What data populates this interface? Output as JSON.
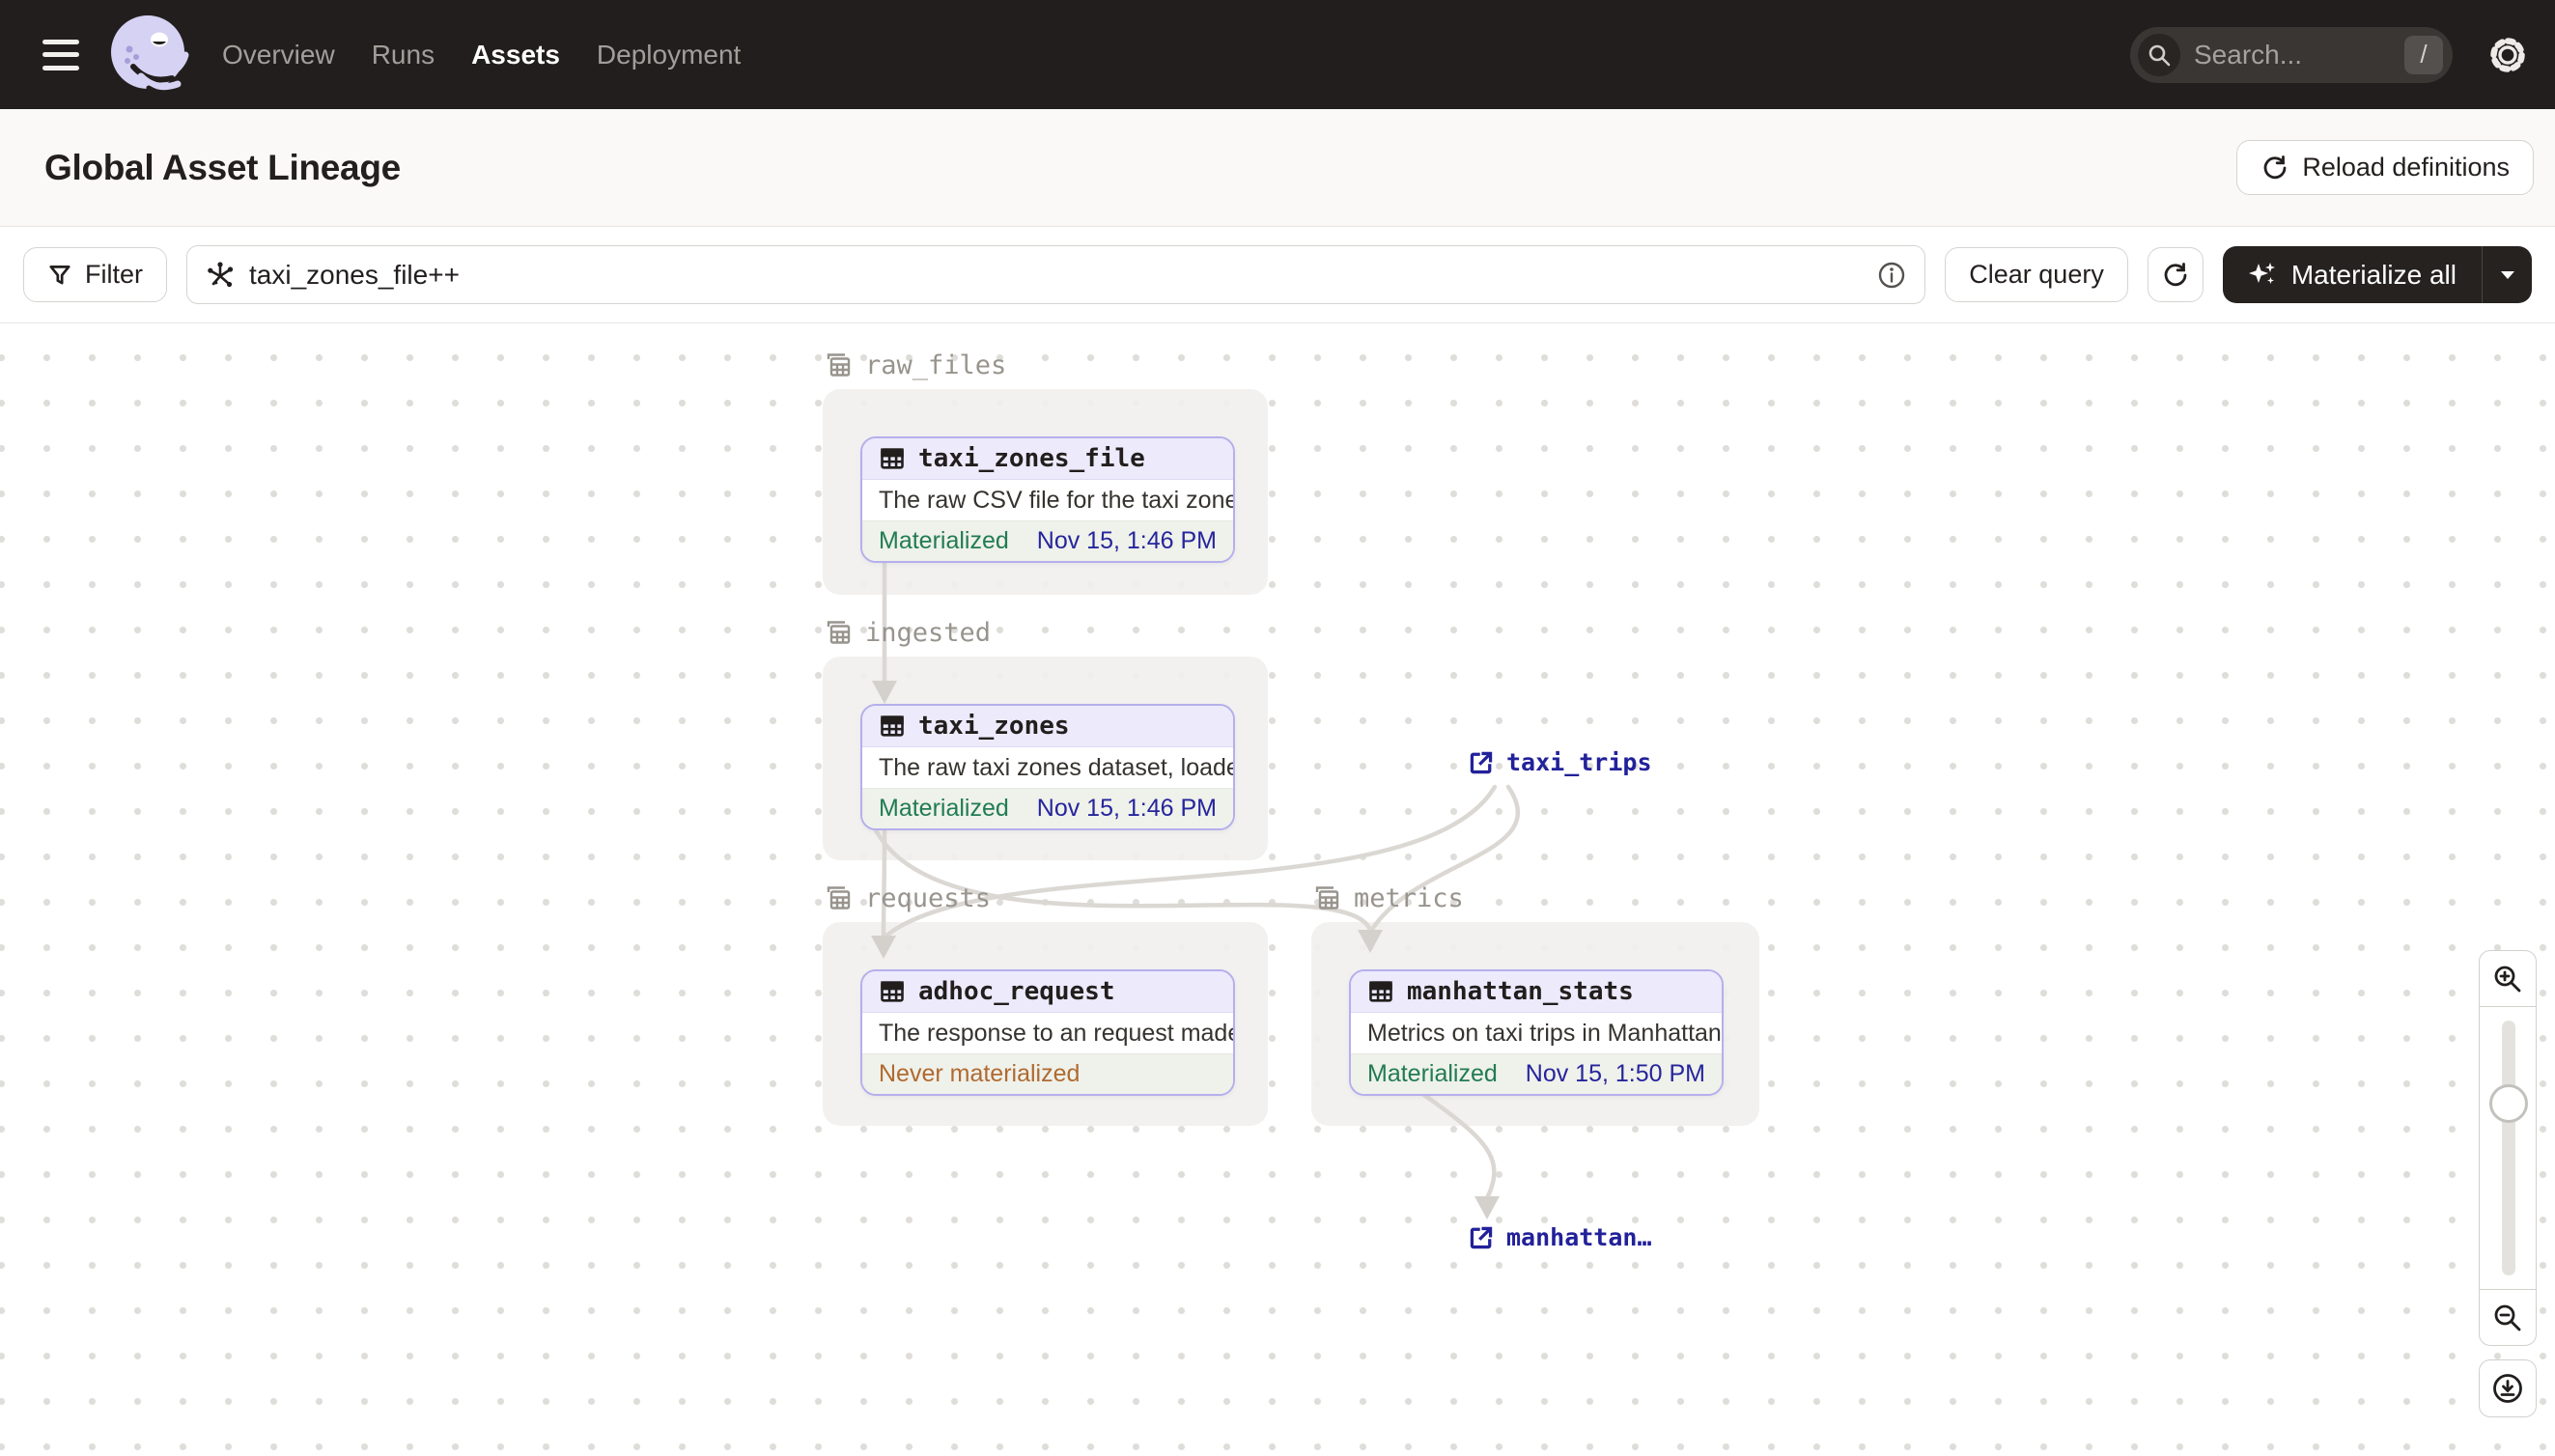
{
  "nav": {
    "tabs": [
      {
        "label": "Overview"
      },
      {
        "label": "Runs"
      },
      {
        "label": "Assets"
      },
      {
        "label": "Deployment"
      }
    ],
    "active_tab": "Assets",
    "search": {
      "placeholder": "Search...",
      "shortcut": "/"
    }
  },
  "header": {
    "title": "Global Asset Lineage",
    "reload_button": "Reload definitions"
  },
  "toolbar": {
    "filter_button": "Filter",
    "query_value": "taxi_zones_file++",
    "clear_button": "Clear query",
    "materialize_button": "Materialize all"
  },
  "graph": {
    "groups": [
      {
        "name": "raw_files"
      },
      {
        "name": "ingested"
      },
      {
        "name": "requests"
      },
      {
        "name": "metrics"
      }
    ],
    "nodes": [
      {
        "name": "taxi_zones_file",
        "group": "raw_files",
        "description": "The raw CSV file for the taxi zones dat...",
        "status": "Materialized",
        "timestamp": "Nov 15, 1:46 PM"
      },
      {
        "name": "taxi_zones",
        "group": "ingested",
        "description": "The raw taxi zones dataset, loaded int...",
        "status": "Materialized",
        "timestamp": "Nov 15, 1:46 PM"
      },
      {
        "name": "adhoc_request",
        "group": "requests",
        "description": "The response to an request made in th...",
        "status": "Never materialized",
        "timestamp": ""
      },
      {
        "name": "manhattan_stats",
        "group": "metrics",
        "description": "Metrics on taxi trips in Manhattan",
        "status": "Materialized",
        "timestamp": "Nov 15, 1:50 PM"
      }
    ],
    "external_assets": [
      {
        "name": "taxi_trips"
      },
      {
        "name": "manhattan…"
      }
    ]
  },
  "colors": {
    "nav_bg": "#221E1D",
    "node_border": "#B5AFEC",
    "node_header_bg": "#ECEAFB",
    "materialized_green": "#217C52",
    "timestamp_navy": "#26259C",
    "never_materialized_amber": "#B06A2F",
    "edge_gray": "#DBD8D4",
    "button_dark": "#262220"
  }
}
